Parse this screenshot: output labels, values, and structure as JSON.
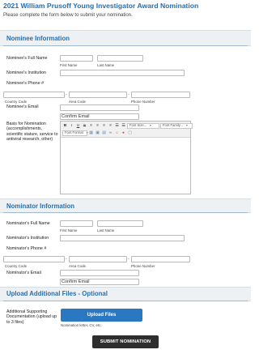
{
  "header": {
    "title": "2021 William Prusoff Young Investigator Award Nomination",
    "subtitle": "Please complete the form below to submit your nomination."
  },
  "nominee": {
    "section_title": "Nominee Information",
    "full_name_label": "Nominee's Full Name",
    "first_name_sub": "First Name",
    "last_name_sub": "Last Name",
    "institution_label": "Nominee's Institution",
    "phone_label": "Nominee's Phone #",
    "country_code_sub": "Country Code",
    "area_code_sub": "Area Code",
    "phone_number_sub": "Phone Number",
    "phone_dash": "-",
    "email_label": "Nominee's Email",
    "confirm_email_placeholder": "Confirm Email",
    "basis_label": "Basis for Nomination (accomplishments, scientific stature, service to antiviral research, other)"
  },
  "editor": {
    "bold": "B",
    "italic": "I",
    "underline": "U",
    "strike": "S",
    "font_size": "Font Size...",
    "font_family": "Font Family...",
    "font_format": "Font Format"
  },
  "nominator": {
    "section_title": "Nominator Information",
    "full_name_label": "Nominator's Full Name",
    "first_name_sub": "First Name",
    "last_name_sub": "Last Name",
    "institution_label": "Nominator's Institution",
    "phone_label": "Nominator's Phone #",
    "country_code_sub": "Country Code",
    "area_code_sub": "Area Code",
    "phone_number_sub": "Phone Number",
    "phone_dash": "-",
    "email_label": "Nominator's Email",
    "confirm_email_placeholder": "Confirm Email"
  },
  "upload": {
    "section_title": "Upload Additional Files - Optional",
    "label": "Additional Supporting Documentation (upload up to 3 files)",
    "button_label": "Upload Files",
    "hint": "Nomination letter, CV, etc."
  },
  "submit": {
    "button_label": "SUBMIT NOMINATION"
  },
  "colors": {
    "accent": "#2a6ea8",
    "upload_button": "#2b78c2",
    "submit_button": "#2e2e2e"
  }
}
